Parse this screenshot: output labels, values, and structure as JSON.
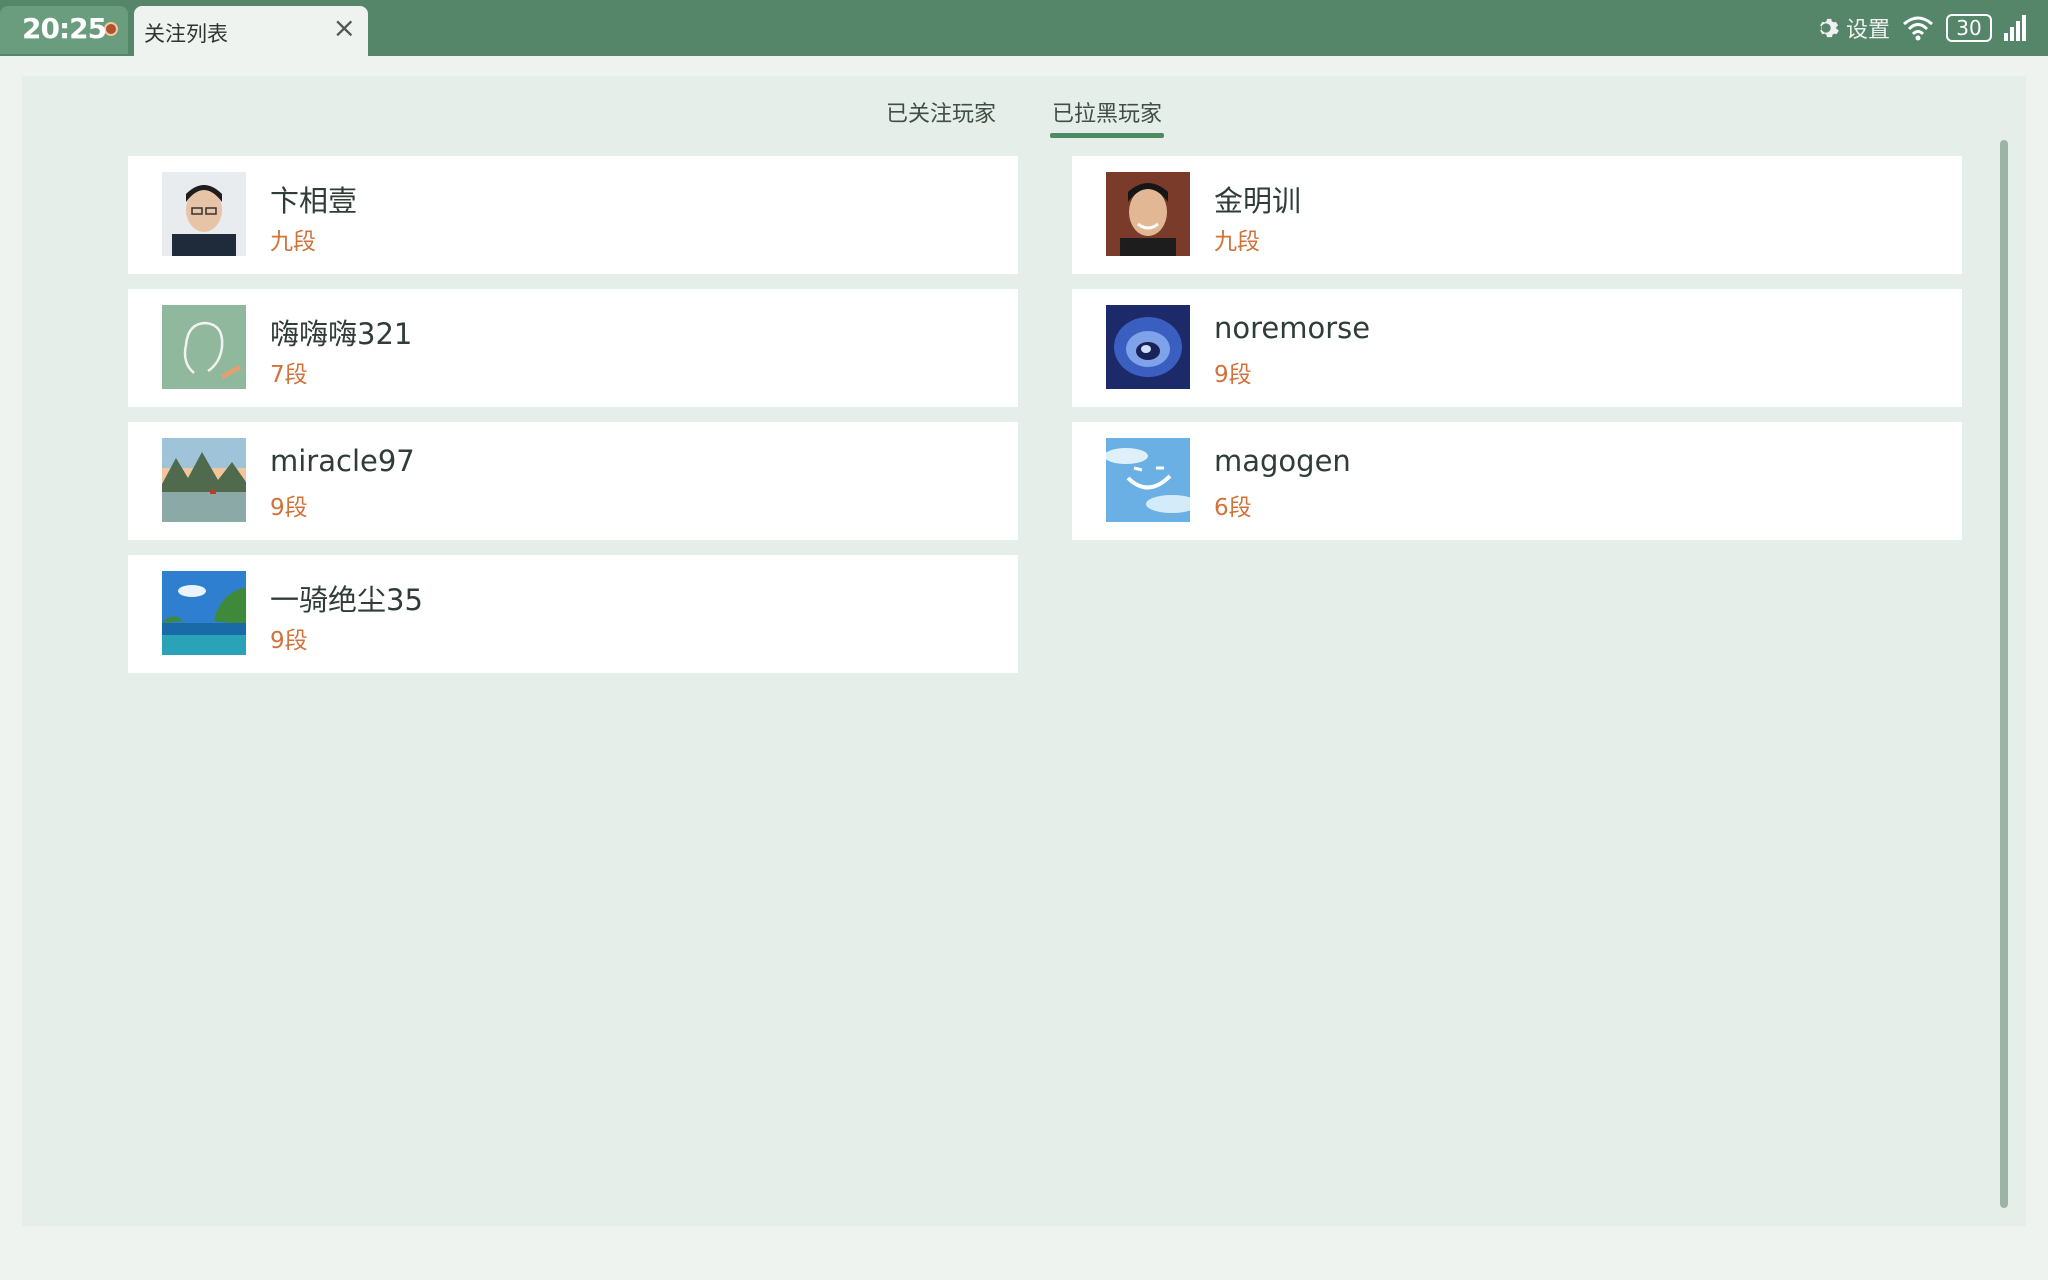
{
  "status": {
    "time": "20:25",
    "settings_label": "设置",
    "battery": "30"
  },
  "window": {
    "tab_title": "关注列表"
  },
  "tabs": {
    "followed": "已关注玩家",
    "blocked": "已拉黑玩家"
  },
  "players": [
    {
      "name": "卞相壹",
      "rank": "九段",
      "avatar": "portrait-avatar"
    },
    {
      "name": "金明训",
      "rank": "九段",
      "avatar": "portrait-avatar"
    },
    {
      "name": "嗨嗨嗨321",
      "rank": "7段",
      "avatar": "default-silhouette-avatar"
    },
    {
      "name": "noremorse",
      "rank": "9段",
      "avatar": "swirl-avatar"
    },
    {
      "name": "miracle97",
      "rank": "9段",
      "avatar": "landscape-avatar"
    },
    {
      "name": "magogen",
      "rank": "6段",
      "avatar": "sky-avatar"
    },
    {
      "name": "一骑绝尘35",
      "rank": "9段",
      "avatar": "lake-avatar"
    }
  ],
  "colors": {
    "header": "#56866a",
    "accent": "#4e8a64",
    "rank": "#d2723a"
  }
}
